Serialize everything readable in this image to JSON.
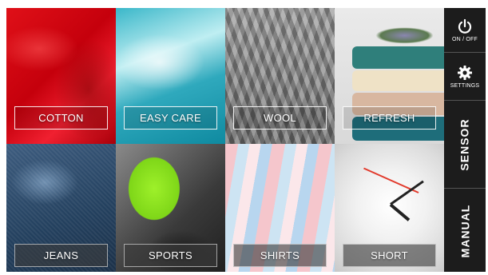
{
  "tiles": [
    {
      "label": "COTTON"
    },
    {
      "label": "EASY CARE"
    },
    {
      "label": "WOOL"
    },
    {
      "label": "REFRESH"
    },
    {
      "label": "JEANS"
    },
    {
      "label": "SPORTS"
    },
    {
      "label": "SHIRTS"
    },
    {
      "label": "SHORT"
    }
  ],
  "side": {
    "power_label": "ON / OFF",
    "settings_label": "SETTINGS",
    "sensor_label": "SENSOR",
    "manual_label": "MANUAL"
  },
  "icons": {
    "power": "power-icon",
    "settings": "gear-icon"
  },
  "colors": {
    "panel": "#1c1c1c",
    "clock_second_hand": "#e23a2c"
  }
}
